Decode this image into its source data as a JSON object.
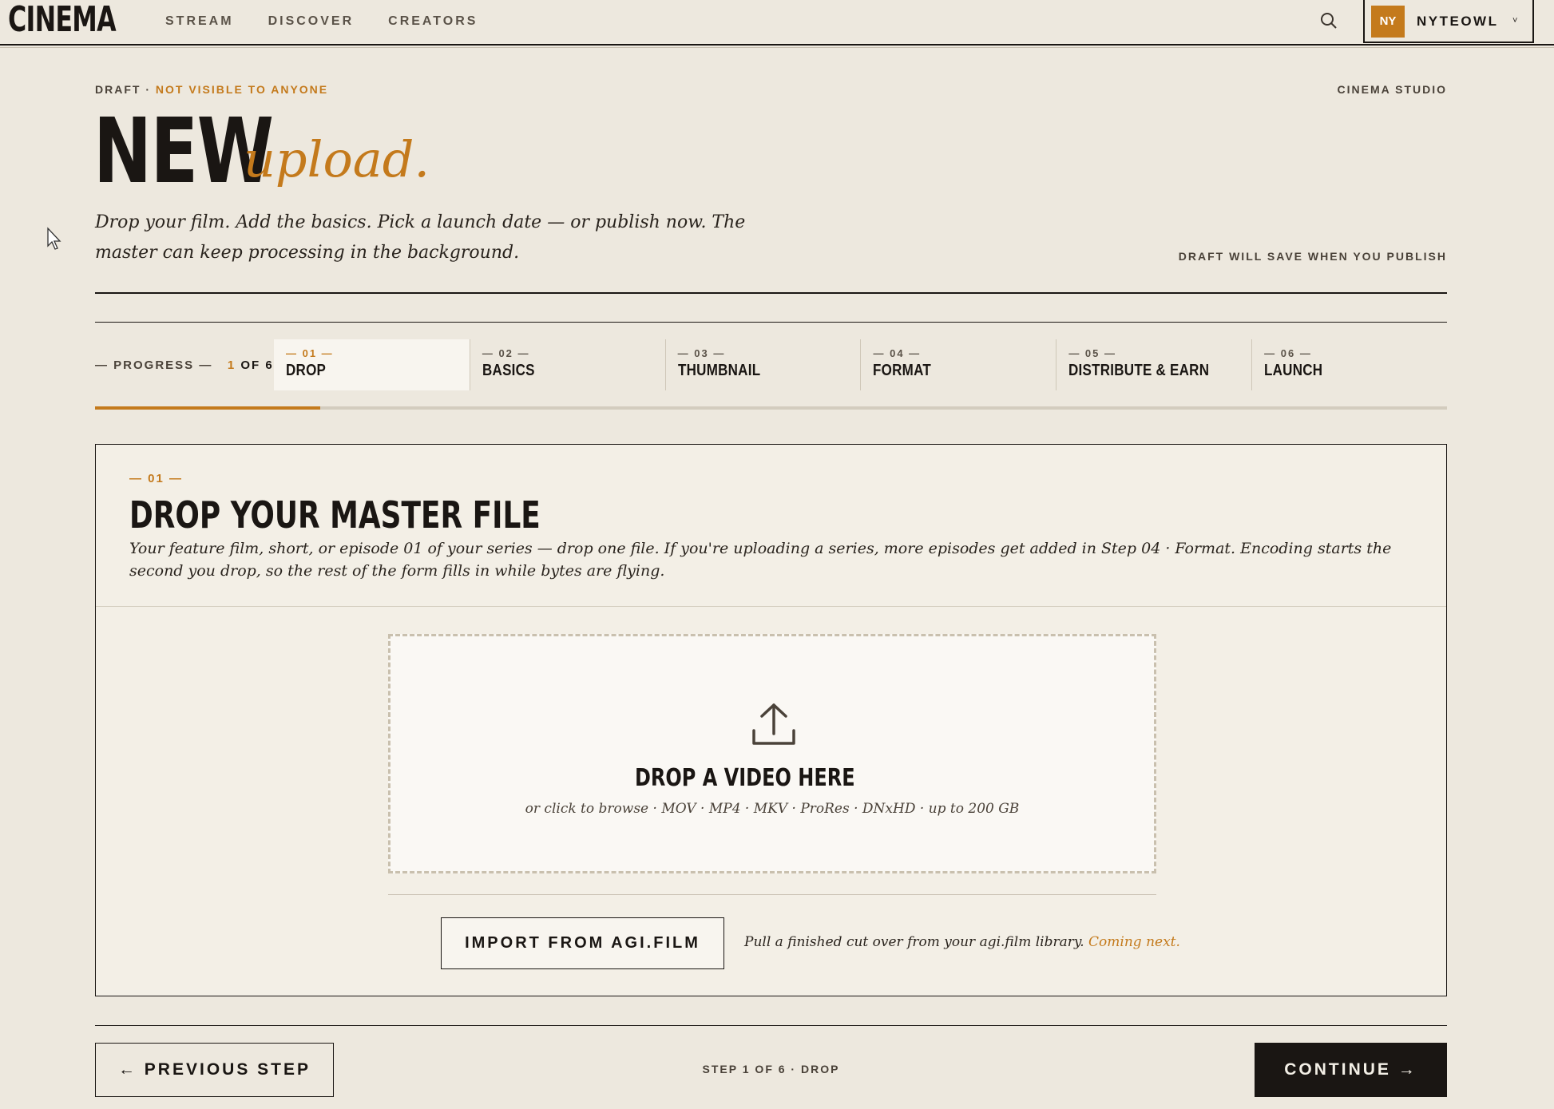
{
  "nav": {
    "logo": "CINEMA",
    "links": [
      "STREAM",
      "DISCOVER",
      "CREATORS"
    ],
    "search_icon": "search-icon",
    "user": {
      "initials": "NY",
      "name": "NYTEOWL",
      "chevron": "˅"
    }
  },
  "header": {
    "draft_label": "DRAFT ·",
    "draft_status": "NOT VISIBLE TO ANYONE",
    "studio": "CINEMA STUDIO",
    "title_main": "NEW",
    "title_accent": "upload.",
    "subtitle": "Drop your film. Add the basics. Pick a launch date — or publish now. The master can keep processing in the background.",
    "save_note": "DRAFT WILL SAVE WHEN YOU PUBLISH"
  },
  "progress": {
    "label_prefix": "— PROGRESS —",
    "current": "1",
    "total_text": "OF 6",
    "fraction": 0.1667,
    "steps": [
      {
        "num": "— 01 —",
        "label": "DROP"
      },
      {
        "num": "— 02 —",
        "label": "BASICS"
      },
      {
        "num": "— 03 —",
        "label": "THUMBNAIL"
      },
      {
        "num": "— 04 —",
        "label": "FORMAT"
      },
      {
        "num": "— 05 —",
        "label": "DISTRIBUTE & EARN"
      },
      {
        "num": "— 06 —",
        "label": "LAUNCH"
      }
    ]
  },
  "card": {
    "num": "— 01 —",
    "title": "DROP YOUR MASTER FILE",
    "description": "Your feature film, short, or episode 01 of your series — drop one file. If you're uploading a series, more episodes get added in Step 04 · Format. Encoding starts the second you drop, so the rest of the form fills in while bytes are flying.",
    "dropzone": {
      "icon": "upload-icon",
      "title": "DROP A VIDEO HERE",
      "subtitle": "or click to browse · MOV · MP4 · MKV · ProRes · DNxHD · up to 200 GB"
    },
    "import_button": "IMPORT FROM AGI.FILM",
    "import_note": "Pull a finished cut over from your agi.film library.",
    "import_coming": "Coming next."
  },
  "footer": {
    "prev_button": "← PREVIOUS STEP",
    "status": "STEP 1 OF 6 · DROP",
    "continue_button": "CONTINUE →"
  },
  "colors": {
    "background": "#ede8de",
    "accent": "#c47a1c",
    "ink": "#1a1613"
  }
}
